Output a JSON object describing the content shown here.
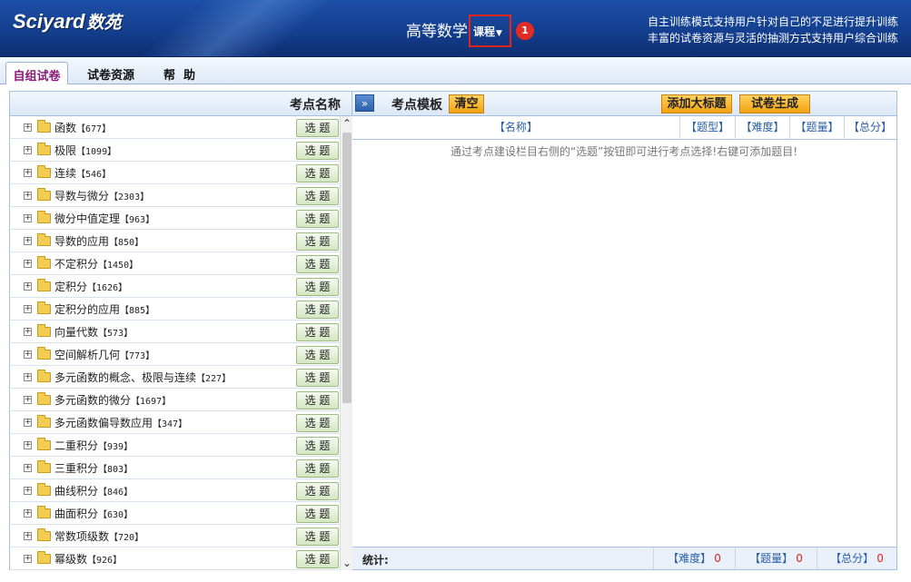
{
  "header": {
    "logo_en": "Sciyard",
    "logo_cn": "数苑",
    "course_title": "高等数学",
    "course_dropdown": "课程",
    "badge": "1",
    "slogan_line1": "自主训练模式支持用户针对自己的不足进行提升训练",
    "slogan_line2": "丰富的试卷资源与灵活的抽测方式支持用户综合训练"
  },
  "tabs": [
    "自组试卷",
    "试卷资源",
    "帮  助"
  ],
  "left_panel": {
    "header": "考点名称",
    "pick_label": "选 题",
    "items": [
      {
        "name": "函数",
        "count": "【677】"
      },
      {
        "name": "极限",
        "count": "【1099】"
      },
      {
        "name": "连续",
        "count": "【546】"
      },
      {
        "name": "导数与微分",
        "count": "【2303】"
      },
      {
        "name": "微分中值定理",
        "count": "【963】"
      },
      {
        "name": "导数的应用",
        "count": "【850】"
      },
      {
        "name": "不定积分",
        "count": "【1450】"
      },
      {
        "name": "定积分",
        "count": "【1626】"
      },
      {
        "name": "定积分的应用",
        "count": "【885】"
      },
      {
        "name": "向量代数",
        "count": "【573】"
      },
      {
        "name": "空间解析几何",
        "count": "【773】"
      },
      {
        "name": "多元函数的概念、极限与连续",
        "count": "【227】"
      },
      {
        "name": "多元函数的微分",
        "count": "【1697】"
      },
      {
        "name": "多元函数偏导数应用",
        "count": "【347】"
      },
      {
        "name": "二重积分",
        "count": "【939】"
      },
      {
        "name": "三重积分",
        "count": "【803】"
      },
      {
        "name": "曲线积分",
        "count": "【846】"
      },
      {
        "name": "曲面积分",
        "count": "【630】"
      },
      {
        "name": "常数项级数",
        "count": "【720】"
      },
      {
        "name": "幂级数",
        "count": "【926】"
      }
    ]
  },
  "right_panel": {
    "expand_icon": "»",
    "title": "考点模板",
    "clear_button": "清空",
    "add_section_button": "添加大标题",
    "generate_button": "试卷生成",
    "columns": [
      "【名称】",
      "【题型】",
      "【难度】",
      "【题量】",
      "【总分】"
    ],
    "hint": "通过考点建设栏目右侧的“选题”按钮即可进行考点选择!右键可添加题目!",
    "footer": {
      "stat_label": "统计:",
      "difficulty_label": "【难度】",
      "difficulty_value": "0",
      "quantity_label": "【题量】",
      "quantity_value": "0",
      "score_label": "【总分】",
      "score_value": "0"
    }
  },
  "colors": {
    "header_blue": "#143f8f",
    "accent_red": "#e1251b",
    "button_yellow": "#f4a20e",
    "link_blue": "#2a5ea8"
  }
}
